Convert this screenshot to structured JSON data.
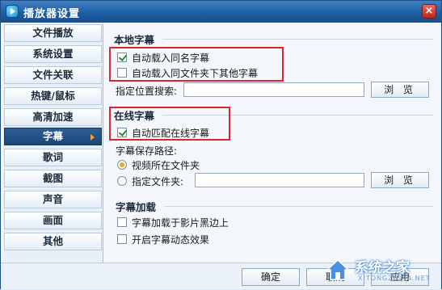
{
  "window": {
    "title": "播放器设置",
    "close_symbol": "×"
  },
  "sidebar": {
    "items": [
      {
        "label": "文件播放"
      },
      {
        "label": "系统设置"
      },
      {
        "label": "文件关联"
      },
      {
        "label": "热键/鼠标"
      },
      {
        "label": "高清加速"
      },
      {
        "label": "字幕",
        "active": true
      },
      {
        "label": "歌词"
      },
      {
        "label": "截图"
      },
      {
        "label": "声音"
      },
      {
        "label": "画面"
      },
      {
        "label": "其他"
      }
    ]
  },
  "local_subtitle": {
    "title": "本地字幕",
    "auto_load_same_name": {
      "label": "自动载入同名字幕",
      "checked": true
    },
    "auto_load_other": {
      "label": "自动载入同文件夹下其他字幕",
      "checked": false
    },
    "search_label": "指定位置搜索:",
    "search_value": "",
    "browse_label": "浏 览"
  },
  "online_subtitle": {
    "title": "在线字幕",
    "auto_match": {
      "label": "自动匹配在线字幕",
      "checked": true
    },
    "save_path_label": "字幕保存路径:",
    "option_video_folder": {
      "label": "视频所在文件夹",
      "checked": true
    },
    "option_custom_folder": {
      "label": "指定文件夹:",
      "checked": false
    },
    "custom_folder_value": "",
    "browse_label": "浏 览"
  },
  "subtitle_loading": {
    "title": "字幕加载",
    "load_on_black_border": {
      "label": "字幕加载于影片黑边上",
      "checked": false
    },
    "dynamic_effect": {
      "label": "开启字幕动态效果",
      "checked": false
    }
  },
  "footer": {
    "ok_label": "确定",
    "cancel_label": "取消",
    "apply_label": "应用"
  },
  "watermark": {
    "text": "系统之家",
    "subtext": "XITONGZHIJIA.NET"
  },
  "colors": {
    "highlight": "#e0242e",
    "titlebar": "#1f5ea3",
    "active_nav": "#1b4677"
  }
}
